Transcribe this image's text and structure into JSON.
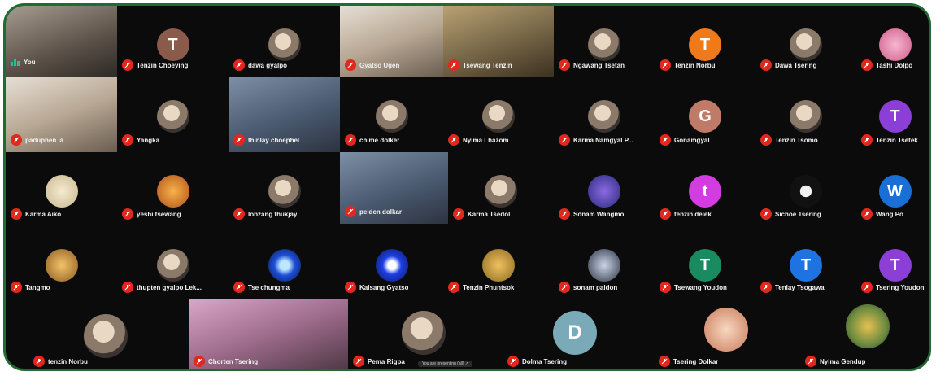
{
  "caption": "You are presenting (all) ↗",
  "tiles": {
    "r0c0": "You",
    "r0c1": "Tenzin Choeying",
    "r0c2": "dawa gyalpo",
    "r0c3": "Gyatso Ugen",
    "r0c4": "Tsewang Tenzin",
    "r0c5": "Ngawang Tsetan",
    "r0c6": "Tenzin Norbu",
    "r0c7": "Dawa Tsering",
    "r0c8": "Tashi Dolpo",
    "r1c0": "paduphen la",
    "r1c1": "Yangka",
    "r1c2": "thinlay choephel",
    "r1c3": "chime dolker",
    "r1c4": "Nyima Lhazom",
    "r1c5": "Karma Namgyal P...",
    "r1c6": "Gonamgyal",
    "r1c7": "Tenzin Tsomo",
    "r1c8": "Tenzin Tsetek",
    "r2c0": "Karma Aiko",
    "r2c1": "yeshi tsewang",
    "r2c2": "lobzang thukjay",
    "r2c3": "pelden dolkar",
    "r2c4": "Karma Tsedol",
    "r2c5": "Sonam Wangmo",
    "r2c6": "tenzin delek",
    "r2c7": "Sichoe Tsering",
    "r2c8": "Wang Po",
    "r3c0": "Tangmo",
    "r3c1": "thupten gyalpo Lek...",
    "r3c2": "Tse chungma",
    "r3c3": "Kalsang Gyatso",
    "r3c4": "Tenzin Phuntsok",
    "r3c5": "sonam paldon",
    "r3c6": "Tsewang Youdon",
    "r3c7": "Tenlay Tsogawa",
    "r3c8": "Tsering Youdon",
    "r4c0": "tenzin Norbu",
    "r4c1": "Chorten Tsering",
    "r4c2": "Pema Rigpa",
    "r4c3": "Dolma Tsering",
    "r4c4": "Tsering Dolkar",
    "r4c5": "Nyima Gendup"
  },
  "avatars": {
    "r0c1": {
      "letter": "T",
      "color": "#8a5a4a"
    },
    "r0c6": {
      "letter": "T",
      "color": "#f07a1a"
    },
    "r1c6": {
      "letter": "G",
      "color": "#c07a68"
    },
    "r1c8": {
      "letter": "T",
      "color": "#8b3fd6"
    },
    "r2c6": {
      "letter": "t",
      "color": "#d23ce0"
    },
    "r2c8": {
      "letter": "W",
      "color": "#1a6fd6"
    },
    "r3c6": {
      "letter": "T",
      "color": "#1a8a60"
    },
    "r3c7": {
      "letter": "T",
      "color": "#1f73e0"
    },
    "r3c8": {
      "letter": "T",
      "color": "#8b3fd6"
    },
    "r4c3": {
      "letter": "D",
      "color": "#7aaab8"
    }
  },
  "colors": {
    "frame": "#1f6b32",
    "mute": "#e0281e",
    "background": "#0b0b0b"
  }
}
